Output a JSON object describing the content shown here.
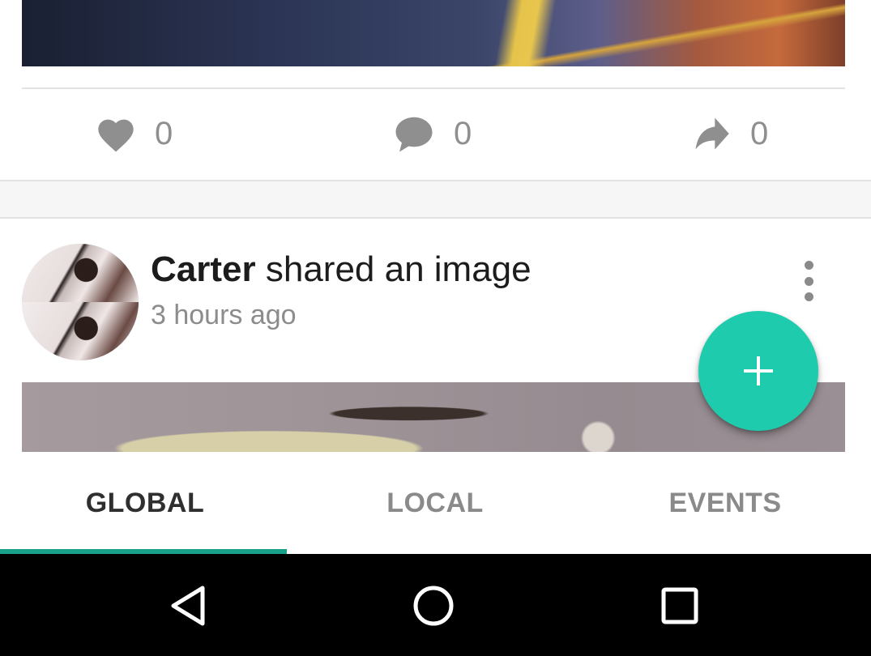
{
  "colors": {
    "accent": "#19a088",
    "fab": "#1fcbad",
    "icon_gray": "#8f8f8f",
    "navbar": "#000000"
  },
  "first_post": {
    "actions": [
      {
        "icon": "heart-icon",
        "count": "0"
      },
      {
        "icon": "comment-icon",
        "count": "0"
      },
      {
        "icon": "share-icon",
        "count": "0"
      }
    ]
  },
  "second_post": {
    "author": "Carter",
    "action_text": " shared an image",
    "time": "3 hours ago",
    "avatar": "avatar-image",
    "more_icon": "more-vert-icon"
  },
  "fab": {
    "icon": "plus-icon"
  },
  "tabs": [
    {
      "label": "GLOBAL",
      "selected": true
    },
    {
      "label": "LOCAL",
      "selected": false
    },
    {
      "label": "EVENTS",
      "selected": false
    }
  ],
  "navbar": {
    "buttons": [
      "back-icon",
      "home-icon",
      "recents-icon"
    ]
  }
}
